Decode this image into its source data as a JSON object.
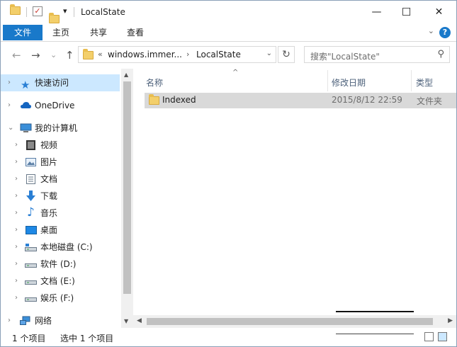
{
  "titlebar": {
    "title": "LocalState",
    "dropdown_glyph": "▾",
    "check_glyph": "✓",
    "controls": {
      "minimize": "—",
      "maximize": "☐",
      "close": "✕"
    }
  },
  "ribbon": {
    "tabs": [
      "文件",
      "主页",
      "共享",
      "查看"
    ],
    "expand_glyph": "⌄",
    "help_glyph": "?"
  },
  "nav": {
    "back": "←",
    "forward": "→",
    "recent": "⌄",
    "up": "↑",
    "breadcrumb": {
      "overflow": "«",
      "parent": "windows.immer...",
      "separator": "›",
      "current": "LocalState"
    },
    "address_dropdown": "⌄",
    "refresh": "↻",
    "search_placeholder": "搜索\"LocalState\"",
    "search_icon": "⚲"
  },
  "navpane": {
    "items": [
      {
        "label": "快速访问",
        "icon": "star-icon",
        "expander": "›",
        "selected": true
      },
      {
        "label": "OneDrive",
        "icon": "cloud-icon",
        "expander": "›"
      },
      {
        "label": "我的计算机",
        "icon": "computer-icon",
        "expander": "⌄"
      },
      {
        "label": "视频",
        "icon": "video-icon",
        "expander": "›"
      },
      {
        "label": "图片",
        "icon": "pictures-icon",
        "expander": "›"
      },
      {
        "label": "文档",
        "icon": "documents-icon",
        "expander": "›"
      },
      {
        "label": "下载",
        "icon": "download-icon",
        "expander": "›"
      },
      {
        "label": "音乐",
        "icon": "music-icon",
        "expander": "›"
      },
      {
        "label": "桌面",
        "icon": "desktop-icon",
        "expander": "›"
      },
      {
        "label": "本地磁盘 (C:)",
        "icon": "local-disk-icon",
        "expander": "›"
      },
      {
        "label": "软件 (D:)",
        "icon": "drive-icon",
        "expander": "›"
      },
      {
        "label": "文档 (E:)",
        "icon": "drive-icon",
        "expander": "›"
      },
      {
        "label": "娱乐 (F:)",
        "icon": "drive-icon",
        "expander": "›"
      },
      {
        "label": "网络",
        "icon": "network-icon",
        "expander": "›"
      }
    ]
  },
  "content": {
    "columns": [
      "名称",
      "修改日期",
      "类型"
    ],
    "sort_glyph": "^",
    "rows": [
      {
        "name": "Indexed",
        "date": "2015/8/12 22:59",
        "type": "文件夹"
      }
    ]
  },
  "scrollbars": {
    "up": "▲",
    "down": "▼",
    "left": "◀",
    "right": "▶"
  },
  "status": {
    "item_count": "1 个项目",
    "selected": "选中 1 个项目"
  },
  "colors": {
    "accent": "#1979ca",
    "selection": "#cce8ff",
    "row_selected": "#d9d9d9",
    "folder": "#f3cf6b"
  }
}
